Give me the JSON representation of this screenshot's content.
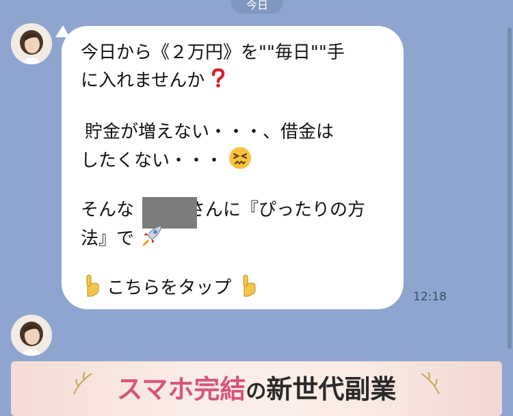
{
  "header": {
    "date_label": "今日"
  },
  "messages": [
    {
      "lines": [
        "今日から《２万円》を\"\"毎日\"\"手",
        "に入れませんか",
        "貯金が増えない・・・、借金は",
        "したくない・・・",
        "そんな",
        "さんに『ぴったりの方",
        "法』で",
        "こちらをタップ"
      ],
      "emoji": [
        "red-question-mark",
        "persevering-face",
        "rocket",
        "pointing-down-hand"
      ],
      "time": "12:18"
    }
  ],
  "banner": {
    "title_pink": "スマホ完結",
    "title_particle": "の",
    "title_dark": "新世代副業"
  }
}
